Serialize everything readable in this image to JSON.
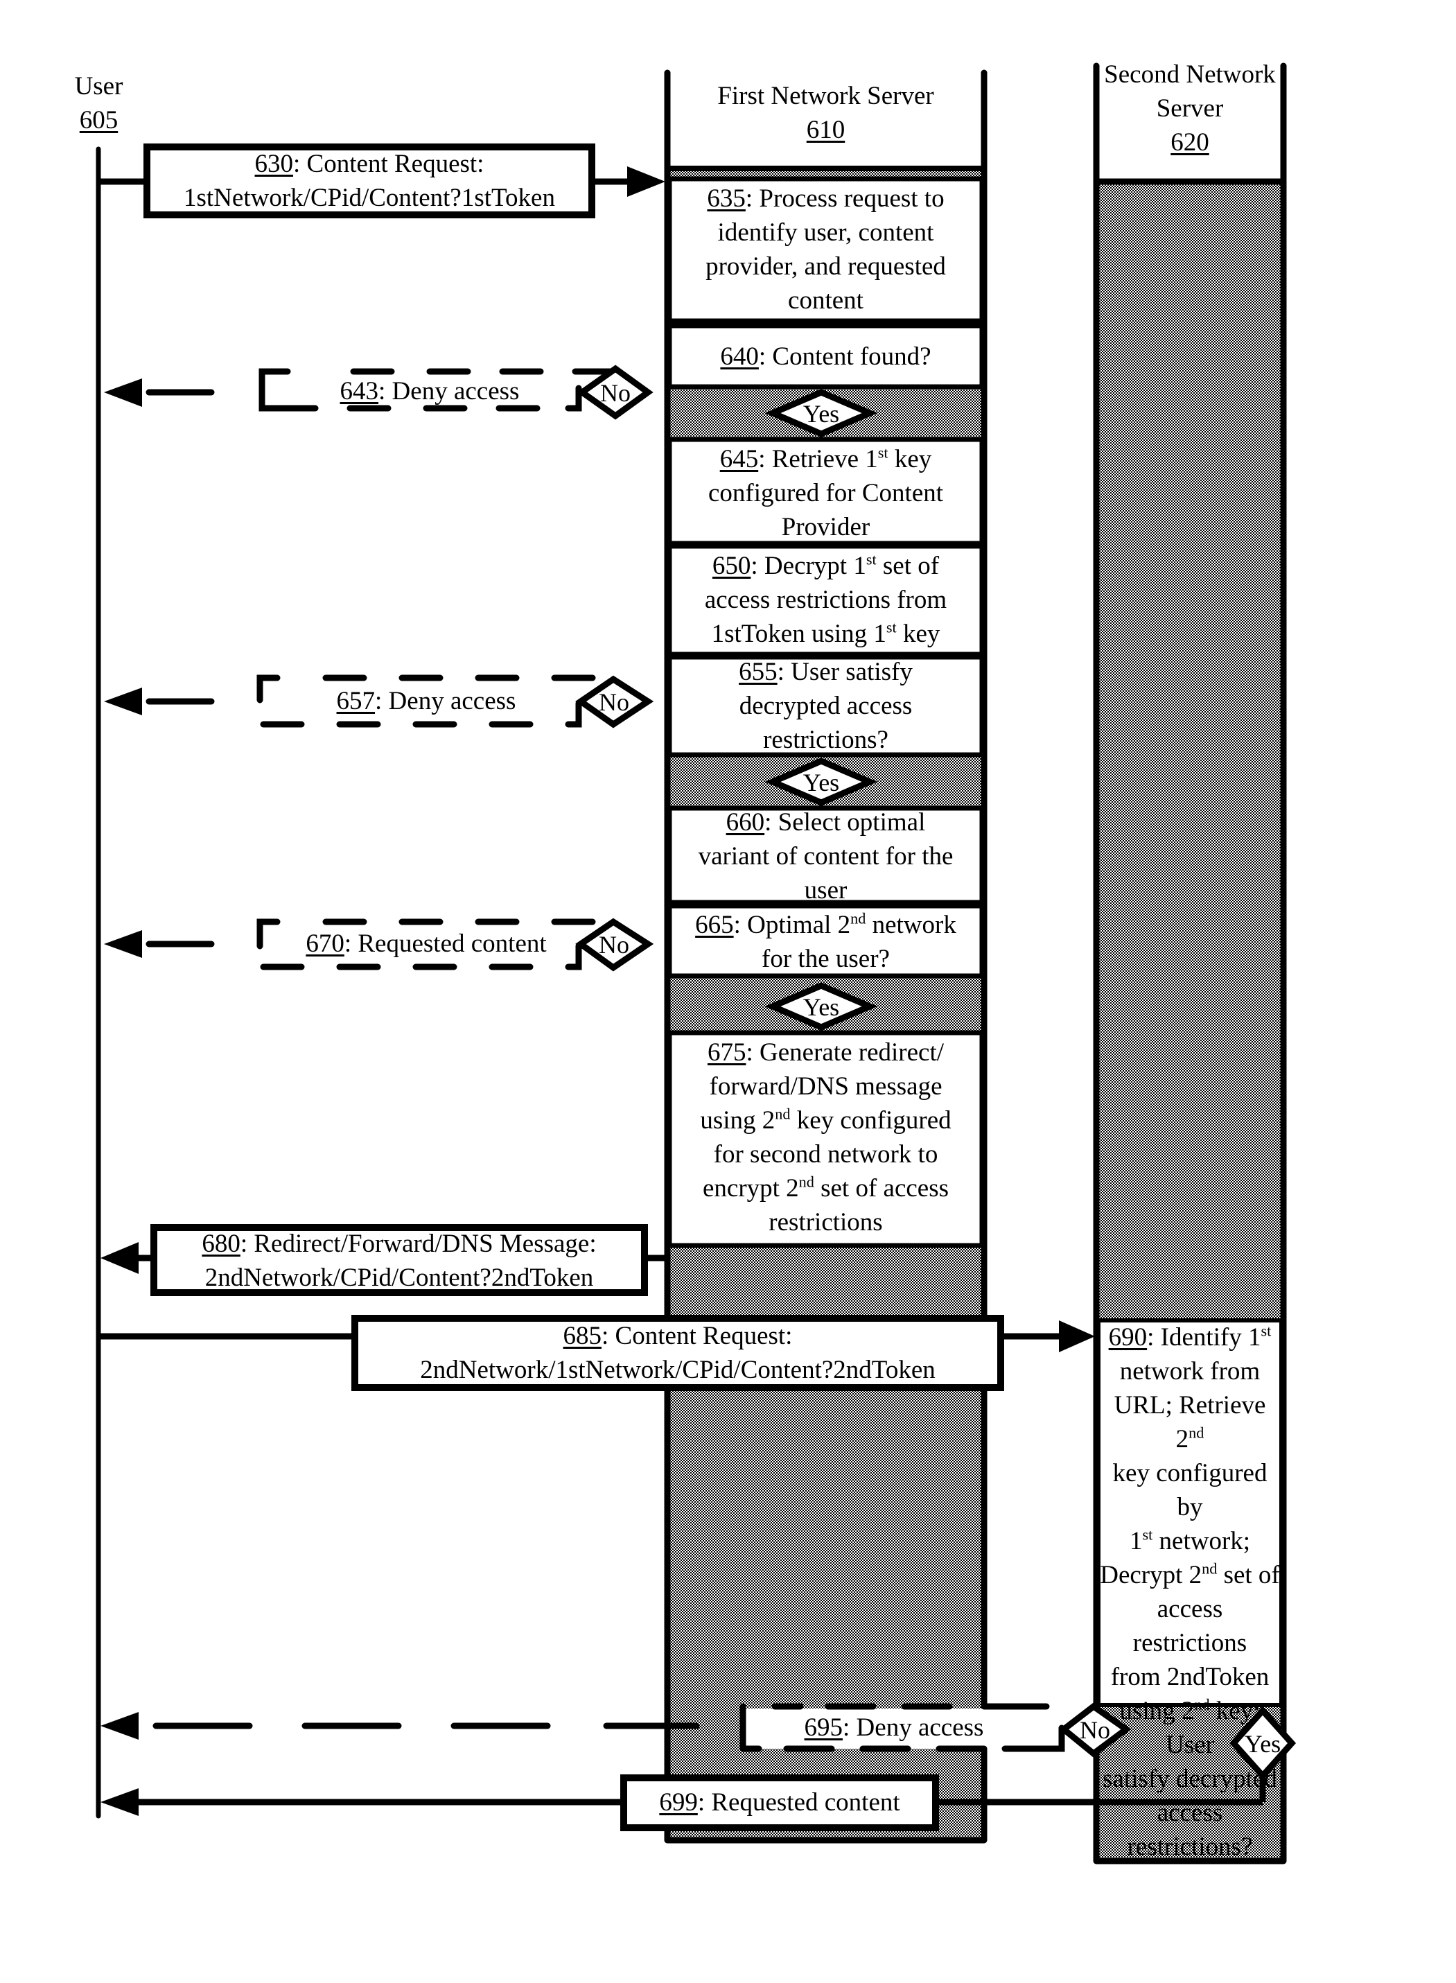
{
  "participants": {
    "user": {
      "name": "User",
      "ref": "605"
    },
    "first_server": {
      "name": "First Network Server",
      "ref": "610"
    },
    "second_server": {
      "name_line1": "Second Network",
      "name_line2": "Server",
      "ref": "620"
    }
  },
  "messages": {
    "m630": {
      "ref": "630",
      "line1": ": Content Request:",
      "line2": "1stNetwork/CPid/Content?1stToken"
    },
    "m643": {
      "ref": "643",
      "text": ": Deny access"
    },
    "m657": {
      "ref": "657",
      "text": ": Deny access"
    },
    "m670": {
      "ref": "670",
      "text": ": Requested content"
    },
    "m680": {
      "ref": "680",
      "line1": ": Redirect/Forward/DNS Message:",
      "line2": "2ndNetwork/CPid/Content?2ndToken"
    },
    "m685": {
      "ref": "685",
      "line1": ": Content Request:",
      "line2": "2ndNetwork/1stNetwork/CPid/Content?2ndToken"
    },
    "m695": {
      "ref": "695",
      "text": ": Deny access"
    },
    "m699": {
      "ref": "699",
      "text": ": Requested content"
    }
  },
  "steps": {
    "s635": {
      "ref": "635",
      "lines": [
        ": Process request to",
        "identify user, content",
        "provider, and requested",
        "content"
      ]
    },
    "s640": {
      "ref": "640",
      "lines": [
        ": Content found?"
      ]
    },
    "s645": {
      "ref": "645",
      "l1a": ": Retrieve 1",
      "l1sup": "st",
      "l1b": " key",
      "l2": "configured for Content",
      "l3": "Provider"
    },
    "s650": {
      "ref": "650",
      "l1a": ": Decrypt 1",
      "l1sup": "st",
      "l1b": " set of",
      "l2": "access restrictions from",
      "l3a": "1stToken using 1",
      "l3sup": "st",
      "l3b": " key"
    },
    "s655": {
      "ref": "655",
      "lines": [
        ": User satisfy",
        "decrypted access",
        "restrictions?"
      ]
    },
    "s660": {
      "ref": "660",
      "lines": [
        ": Select optimal",
        "variant of content for the",
        "user"
      ]
    },
    "s665": {
      "ref": "665",
      "l1a": ": Optimal 2",
      "l1sup": "nd",
      "l1b": " network",
      "l2": "for the user?"
    },
    "s675": {
      "ref": "675",
      "l1": ": Generate redirect/",
      "l2": "forward/DNS message",
      "l3a": "using 2",
      "l3sup": "nd",
      "l3b": " key configured",
      "l4": "for second network to",
      "l5a": "encrypt 2",
      "l5sup": "nd",
      "l5b": " set of access",
      "l6": "restrictions"
    },
    "s690": {
      "ref": "690",
      "l1a": ": Identify 1",
      "l1sup": "st",
      "l2": "network from",
      "l3a": "URL; Retrieve 2",
      "l3sup": "nd",
      "l4": "key configured by",
      "l5a": "1",
      "l5sup": "st",
      "l5b": " network;",
      "l6a": "Decrypt 2",
      "l6sup": "nd",
      "l6b": " set of",
      "l7": "access restrictions",
      "l8": "from 2ndToken",
      "l9a": "using 2",
      "l9sup": "nd",
      "l9b": " key; User",
      "l10": "satisfy decrypted",
      "l11": "access restrictions?"
    }
  },
  "decisions": {
    "yes_label": "Yes",
    "no_label": "No"
  }
}
